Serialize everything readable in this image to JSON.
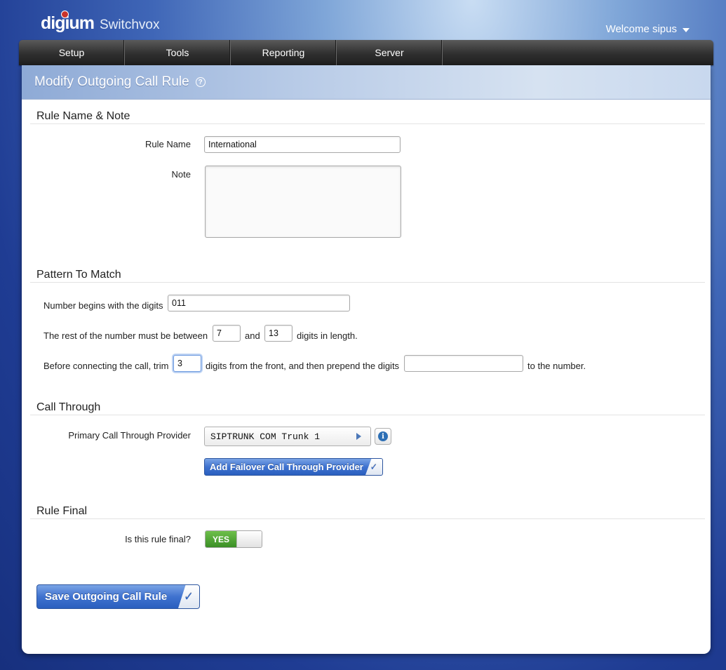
{
  "header": {
    "logo_brand": "digium",
    "logo_product": "Switchvox",
    "welcome": "Welcome sipus"
  },
  "nav": {
    "items": [
      "Setup",
      "Tools",
      "Reporting",
      "Server"
    ]
  },
  "page": {
    "title": "Modify Outgoing Call Rule"
  },
  "rule_name_section": {
    "title": "Rule Name & Note",
    "rule_name_label": "Rule Name",
    "rule_name_value": "International",
    "note_label": "Note",
    "note_value": ""
  },
  "pattern_section": {
    "title": "Pattern To Match",
    "begins_label": "Number begins with the digits",
    "begins_value": "011",
    "rest_label_pre": "The rest of the number must be between",
    "rest_min": "7",
    "rest_and": "and",
    "rest_max": "13",
    "rest_label_post": "digits in length.",
    "trim_label_pre": "Before connecting the call, trim",
    "trim_value": "3",
    "trim_label_mid": "digits from the front, and then prepend the digits",
    "prepend_value": "",
    "trim_label_post": "to the number."
  },
  "call_through_section": {
    "title": "Call Through",
    "primary_label": "Primary Call Through Provider",
    "primary_value": "SIPTRUNK COM Trunk 1",
    "add_failover_label": "Add Failover Call Through Provider"
  },
  "rule_final_section": {
    "title": "Rule Final",
    "question": "Is this rule final?",
    "toggle_on_label": "YES"
  },
  "save_button": "Save Outgoing Call Rule"
}
